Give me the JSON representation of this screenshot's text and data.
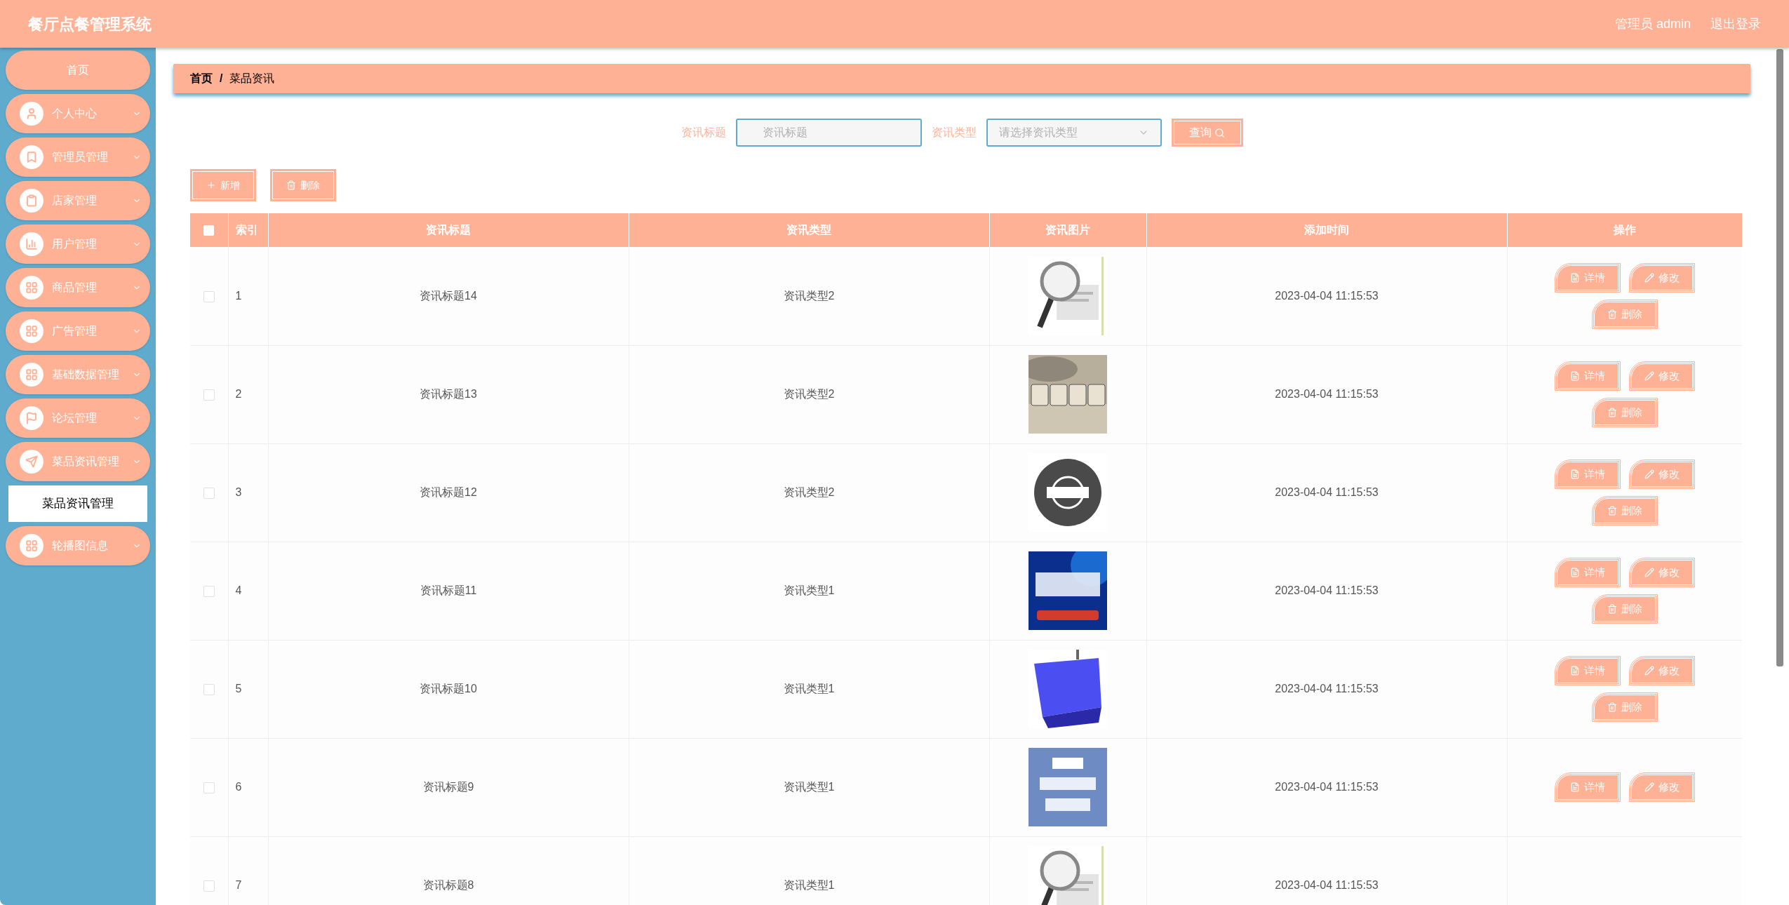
{
  "header": {
    "title": "餐厅点餐管理系统",
    "user": "管理员 admin",
    "logout": "退出登录"
  },
  "sidebar": {
    "items": [
      {
        "kind": "link",
        "label": "首页"
      },
      {
        "kind": "menu",
        "label": "个人中心"
      },
      {
        "kind": "menu",
        "label": "管理员管理"
      },
      {
        "kind": "menu",
        "label": "店家管理"
      },
      {
        "kind": "menu",
        "label": "用户管理"
      },
      {
        "kind": "menu",
        "label": "商品管理"
      },
      {
        "kind": "menu",
        "label": "广告管理"
      },
      {
        "kind": "menu",
        "label": "基础数据管理"
      },
      {
        "kind": "menu",
        "label": "论坛管理"
      },
      {
        "kind": "menu",
        "label": "菜品资讯管理",
        "children": [
          {
            "label": "菜品资讯管理",
            "selected": true
          }
        ]
      },
      {
        "kind": "menu",
        "label": "轮播图信息"
      }
    ]
  },
  "breadcrumb": [
    "首页",
    "/",
    "菜品资讯"
  ],
  "search": {
    "title_label": "资讯标题",
    "title_placeholder": "资讯标题",
    "type_label": "资讯类型",
    "type_placeholder": "请选择资讯类型",
    "button": "查询"
  },
  "toolbar": {
    "add": "新增",
    "delete": "删除"
  },
  "table": {
    "columns": [
      "索引",
      "资讯标题",
      "资讯类型",
      "资讯图片",
      "添加时间",
      "操作"
    ],
    "header_checked": false,
    "rows": [
      {
        "checked": false,
        "index": "1",
        "title": "资讯标题14",
        "type": "资讯类型2",
        "image": {
          "kind": "picture"
        },
        "time": "2023-04-04 11:15:53",
        "actions": [
          "详情",
          "修改",
          "删除"
        ]
      },
      {
        "checked": false,
        "index": "2",
        "title": "资讯标题13",
        "type": "资讯类型2",
        "image": {
          "kind": "picture"
        },
        "time": "2023-04-04 11:15:53",
        "actions": [
          "详情",
          "修改",
          "删除"
        ]
      },
      {
        "checked": false,
        "index": "3",
        "title": "资讯标题12",
        "type": "资讯类型2",
        "image": {
          "kind": "picture"
        },
        "time": "2023-04-04 11:15:53",
        "actions": [
          "详情",
          "修改",
          "删除"
        ]
      },
      {
        "checked": false,
        "index": "4",
        "title": "资讯标题11",
        "type": "资讯类型1",
        "image": {
          "kind": "picture"
        },
        "time": "2023-04-04 11:15:53",
        "actions": [
          "详情",
          "修改",
          "删除"
        ]
      },
      {
        "checked": false,
        "index": "5",
        "title": "资讯标题10",
        "type": "资讯类型1",
        "image": {
          "kind": "picture"
        },
        "time": "2023-04-04 11:15:53",
        "actions": [
          "详情",
          "修改",
          "删除"
        ]
      },
      {
        "checked": false,
        "index": "6",
        "title": "资讯标题9",
        "type": "资讯类型1",
        "image": {
          "kind": "picture"
        },
        "time": "2023-04-04 11:15:53",
        "actions": [
          "详情",
          "修改"
        ]
      },
      {
        "checked": false,
        "index": "7",
        "title": "资讯标题8",
        "type": "资讯类型1",
        "image": {
          "kind": "picture"
        },
        "time": "2023-04-04 11:15:53",
        "actions": []
      }
    ]
  }
}
